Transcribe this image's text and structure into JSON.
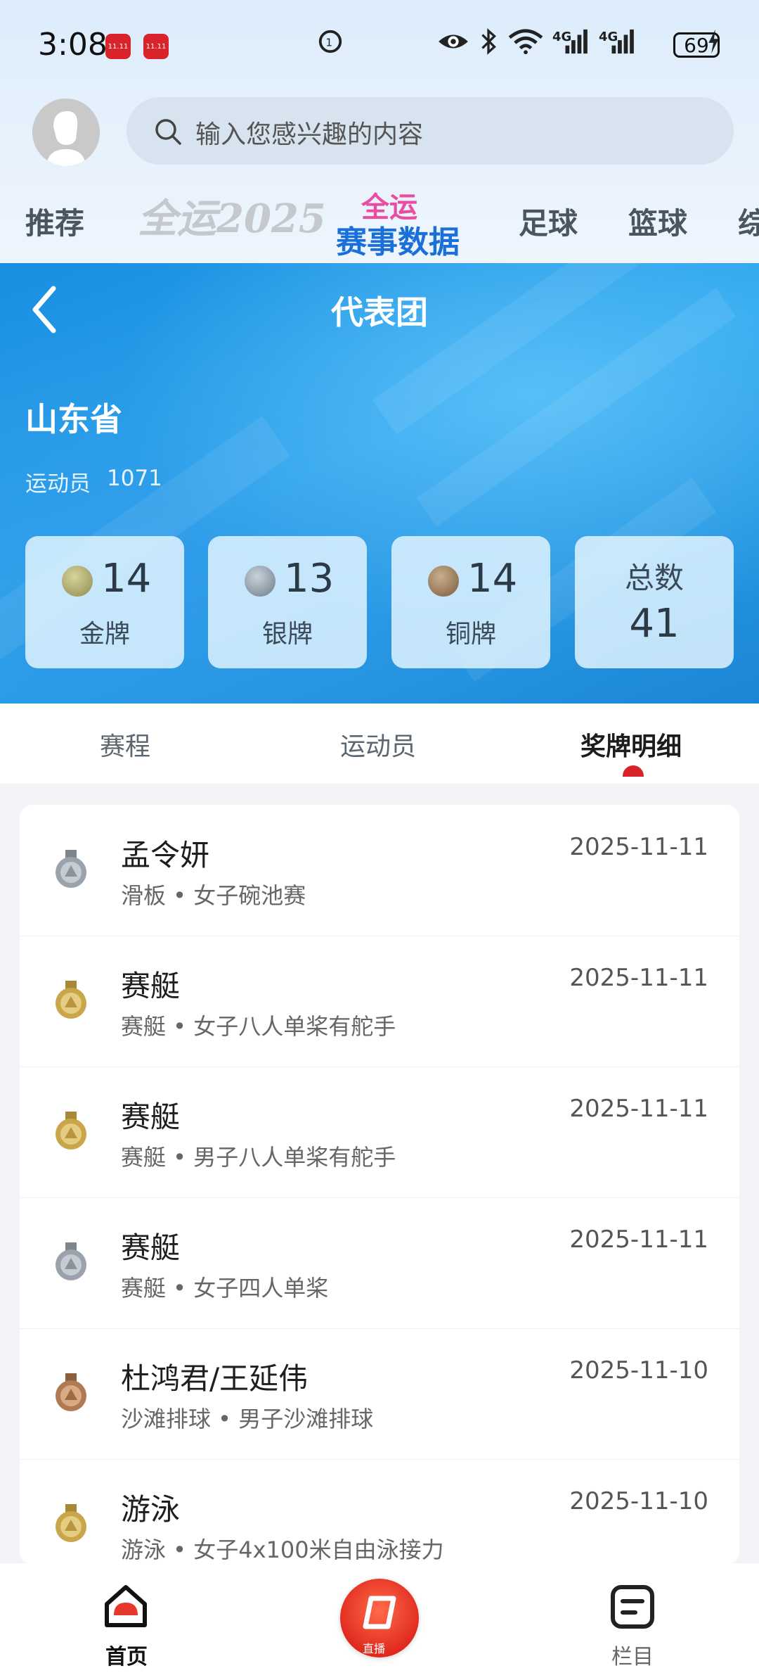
{
  "status_bar": {
    "time": "3:08",
    "network1": "4G",
    "network2": "4G",
    "battery": "69",
    "badge": "11.11"
  },
  "header": {
    "search_placeholder": "输入您感兴趣的内容"
  },
  "category_tabs": {
    "recommend": "推荐",
    "logo_text": "全运2025",
    "data_top": "全运",
    "data_bottom": "赛事数据",
    "football": "足球",
    "basketball": "篮球",
    "overflow": "综"
  },
  "hero": {
    "title": "代表团",
    "province": "山东省",
    "athletes_label": "运动员",
    "athletes_count": "1071",
    "medals": [
      {
        "label": "金牌",
        "count": "14",
        "color": "#b7a04a"
      },
      {
        "label": "银牌",
        "count": "13",
        "color": "#8c9aa6"
      },
      {
        "label": "铜牌",
        "count": "14",
        "color": "#9a7656"
      }
    ],
    "total_label": "总数",
    "total_value": "41"
  },
  "subtabs": {
    "schedule": "赛程",
    "athletes": "运动员",
    "medal_detail": "奖牌明细",
    "active": "medal_detail"
  },
  "medal_list": [
    {
      "name": "孟令妍",
      "event": "滑板 • 女子碗池赛",
      "date": "2025-11-11",
      "medal": "silver"
    },
    {
      "name": "赛艇",
      "event": "赛艇 • 女子八人单桨有舵手",
      "date": "2025-11-11",
      "medal": "gold"
    },
    {
      "name": "赛艇",
      "event": "赛艇 • 男子八人单桨有舵手",
      "date": "2025-11-11",
      "medal": "gold"
    },
    {
      "name": "赛艇",
      "event": "赛艇 • 女子四人单桨",
      "date": "2025-11-11",
      "medal": "silver"
    },
    {
      "name": "杜鸿君/王延伟",
      "event": "沙滩排球 • 男子沙滩排球",
      "date": "2025-11-10",
      "medal": "bronze"
    },
    {
      "name": "游泳",
      "event": "游泳 • 女子4x100米自由泳接力",
      "date": "2025-11-10",
      "medal": "gold"
    }
  ],
  "medal_colors": {
    "gold": "#c9a64a",
    "silver": "#9aa3ab",
    "bronze": "#b07a52"
  },
  "bottom_nav": {
    "home": "首页",
    "live": "直播",
    "column": "栏目"
  }
}
